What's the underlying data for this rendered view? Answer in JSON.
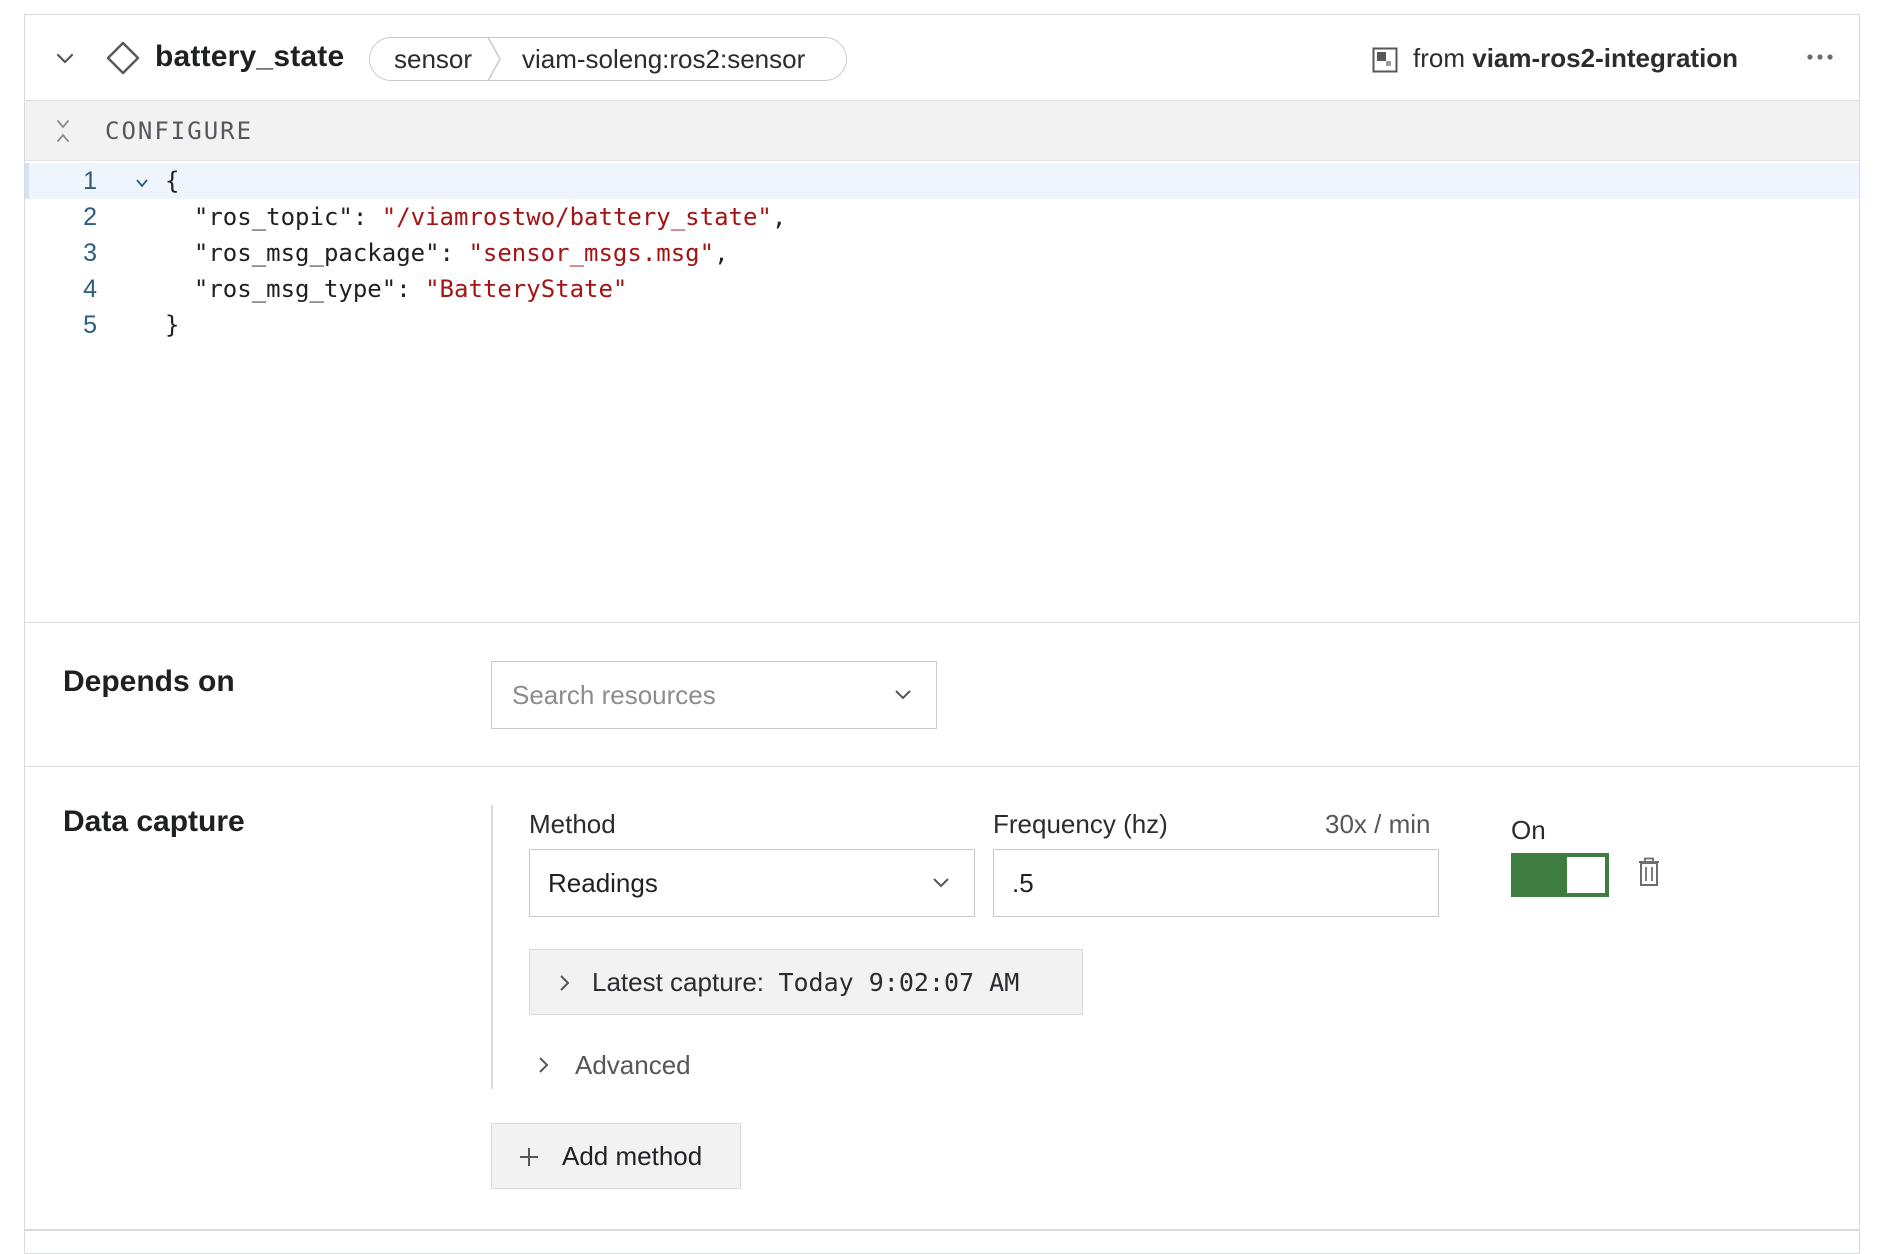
{
  "header": {
    "resource_name": "battery_state",
    "api": "sensor",
    "model": "viam-soleng:ros2:sensor",
    "from_prefix": "from",
    "from_module": "viam-ros2-integration"
  },
  "configure": {
    "label": "CONFIGURE",
    "code_lines": [
      {
        "num": "1",
        "text": "{"
      },
      {
        "num": "2",
        "key": "  \"ros_topic\": ",
        "value": "\"/viamrostwo/battery_state\"",
        "tail": ","
      },
      {
        "num": "3",
        "key": "  \"ros_msg_package\": ",
        "value": "\"sensor_msgs.msg\"",
        "tail": ","
      },
      {
        "num": "4",
        "key": "  \"ros_msg_type\": ",
        "value": "\"BatteryState\"",
        "tail": ""
      },
      {
        "num": "5",
        "text": "}"
      }
    ]
  },
  "depends_on": {
    "label": "Depends on",
    "placeholder": "Search resources"
  },
  "data_capture": {
    "label": "Data capture",
    "method_label": "Method",
    "method_value": "Readings",
    "frequency_label": "Frequency (hz)",
    "frequency_value": ".5",
    "rate_text": "30x / min",
    "toggle_label": "On",
    "toggle_on": true,
    "latest_capture_label": "Latest capture:",
    "latest_capture_value": "Today 9:02:07 AM",
    "advanced_label": "Advanced",
    "add_method_label": "Add method"
  },
  "colors": {
    "toggle_on": "#3e7d3f",
    "string_literal": "#a31515",
    "line_number": "#2d5d7b"
  },
  "icons": {
    "collapse": "chevron-down-icon",
    "resource": "diamond-icon",
    "module": "module-icon",
    "menu": "more-horizontal-icon",
    "configure_collapse": "collapse-vertical-icon",
    "delete": "trash-icon",
    "add": "plus-icon"
  }
}
